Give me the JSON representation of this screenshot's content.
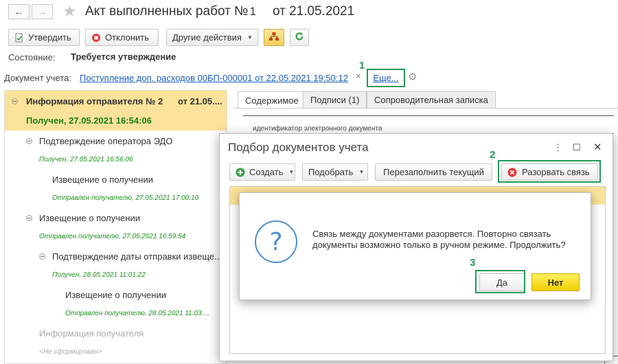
{
  "header": {
    "title": "Акт выполненных работ №",
    "number": "1",
    "date": "от 21.05.2021"
  },
  "toolbar": {
    "approve": "Утвердить",
    "reject": "Отклонить",
    "other_actions": "Другие действия"
  },
  "status": {
    "label": "Состояние:",
    "value": "Требуется утверждение"
  },
  "document": {
    "label": "Документ учета:",
    "link": "Поступление доп. расходов 00БП-000001 от 22.05.2021 19:50:12",
    "clear": "×",
    "more": "Еще..."
  },
  "markers": {
    "m1": "1",
    "m2": "2",
    "m3": "3"
  },
  "tree": {
    "root_title": "Информация отправителя № 2",
    "root_date": "от 21.05....",
    "root_status": "Получен, 27.05.2021 16:54:06",
    "items": [
      {
        "title": "Подтверждение оператора ЭДО",
        "sub": "Получен, 27.05.2021 16:56:06"
      },
      {
        "title": "Извещение о получении",
        "sub": "Отправлен получателю, 27.05.2021 17:00:10"
      },
      {
        "title": "Извещение о получении",
        "sub": "Отправлен получателю, 27.05.2021 16:59:54"
      },
      {
        "title": "Подтверждение даты отправки извеще...",
        "sub": "Получен, 28.05.2021 11:01:22"
      },
      {
        "title": "Извещение о получении",
        "sub": "Отправлен получателю, 28.05.2021 11:03:..."
      },
      {
        "title": "Информация получателя",
        "sub": "<Не сформирован>"
      }
    ]
  },
  "tabs": [
    "Содержимое",
    "Подписи (1)",
    "Сопроводительная записка"
  ],
  "bg_doc": {
    "line1": "идентификатор электронного документа"
  },
  "dialog": {
    "title": "Подбор документов учета",
    "create": "Создать",
    "pick": "Подобрать",
    "refill": "Перезаполнить текущий",
    "break_link": "Разорвать связь"
  },
  "confirm": {
    "message": "Связь между документами разорвется. Повторно связать документы возможно только в ручном режиме. Продолжить?",
    "yes": "Да",
    "no": "Нет"
  }
}
